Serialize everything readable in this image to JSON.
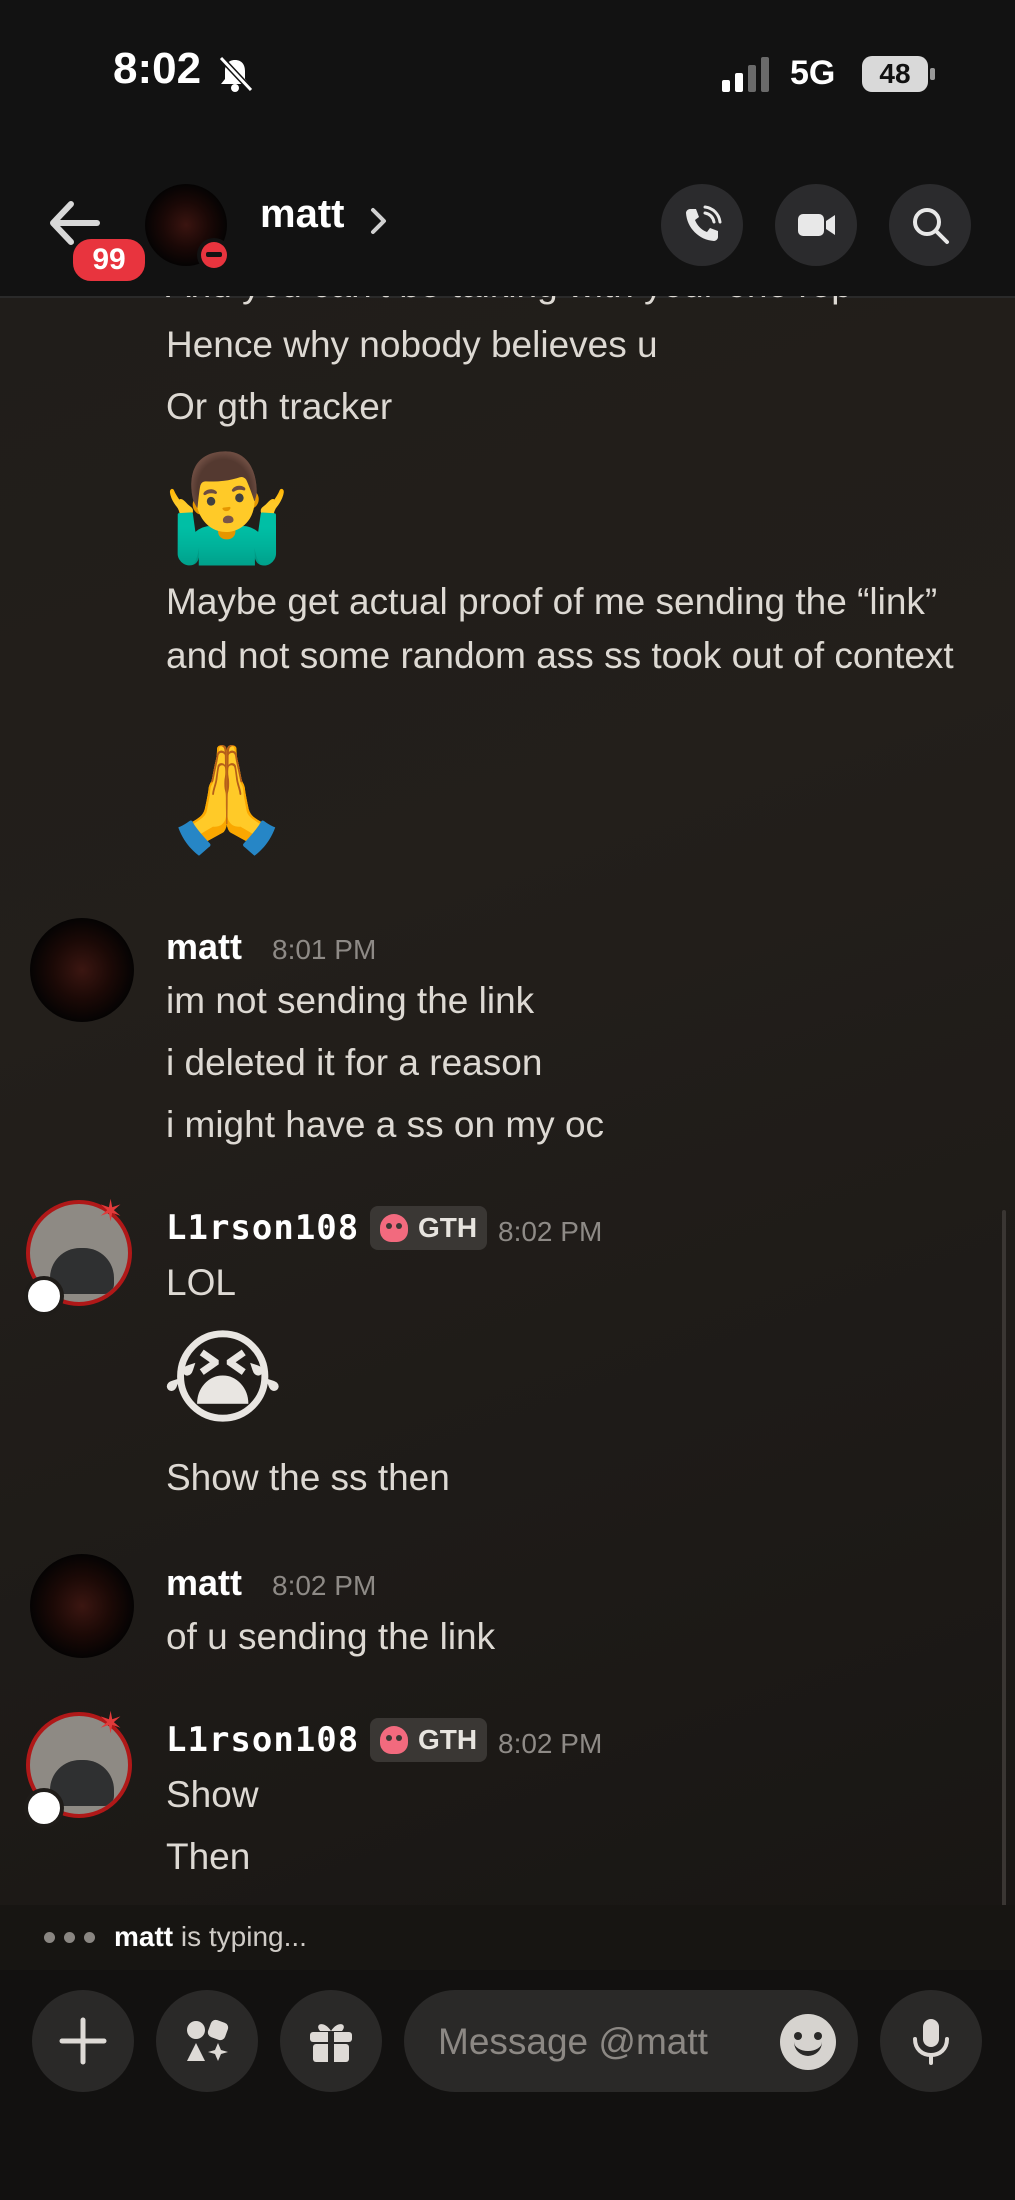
{
  "status_bar": {
    "time": "8:02",
    "network": "5G",
    "battery": "48"
  },
  "header": {
    "unread_badge": "99",
    "contact_name": "matt"
  },
  "messages": {
    "partial_line": "And you can't be talking with your one rep",
    "m1": "Hence why nobody believes u",
    "m2": "Or gth tracker",
    "m3_emoji": "🤷‍♂️",
    "m4": "Maybe get actual proof of me sending the “link” and not some random ass ss took out of context",
    "m5_emoji": "🙏",
    "g2": {
      "author": "matt",
      "time": "8:01 PM",
      "lines": [
        "im not sending the link",
        "i deleted it for a reason",
        "i might have a ss on my oc"
      ]
    },
    "g3": {
      "author": "L1rson108",
      "tag": "GTH",
      "time": "8:02 PM",
      "line1": "LOL",
      "emoji": "😭",
      "line2": "Show the ss then"
    },
    "g4": {
      "author": "matt",
      "time": "8:02 PM",
      "line1": "of u sending the link"
    },
    "g5": {
      "author": "L1rson108",
      "tag": "GTH",
      "time": "8:02 PM",
      "lines": [
        "Show",
        "Then"
      ]
    }
  },
  "typing": {
    "name": "matt",
    "suffix": " is typing..."
  },
  "composer": {
    "placeholder": "Message @matt"
  },
  "icons": [
    "back-arrow-icon",
    "voice-call-icon",
    "video-call-icon",
    "search-icon",
    "plus-icon",
    "apps-icon",
    "gift-icon",
    "emoji-icon",
    "microphone-icon"
  ],
  "colors": {
    "badge_red": "#e8343e",
    "background": "#1f1c19",
    "tag_bg": "#3a3734"
  }
}
